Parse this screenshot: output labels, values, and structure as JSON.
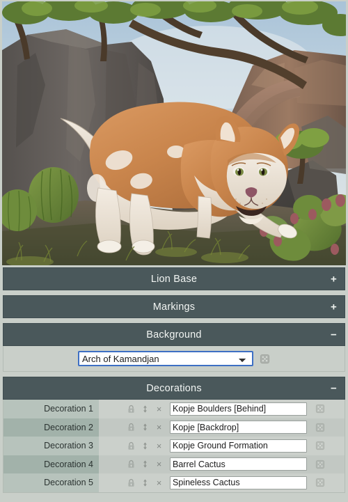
{
  "preview": {
    "alt_title": "Lion Base preview illustration",
    "scene_name": "Arch of Kamandjan",
    "subject": "lioness"
  },
  "sections": [
    {
      "title": "Lion Base",
      "toggle": "+",
      "expanded": false
    },
    {
      "title": "Markings",
      "toggle": "+",
      "expanded": false
    },
    {
      "title": "Background",
      "toggle": "−",
      "expanded": true,
      "select_value": "Arch of Kamandjan",
      "options": [
        "Arch of Kamandjan"
      ],
      "randomize_icon": "dice-icon"
    },
    {
      "title": "Decorations",
      "toggle": "−",
      "expanded": true
    }
  ],
  "decorations": {
    "lock_icon": "lock-icon",
    "move_icon": "move-vertical-icon",
    "remove_icon": "×",
    "randomize_icon": "dice-icon",
    "rows": [
      {
        "label": "Decoration 1",
        "value": "Kopje Boulders [Behind]"
      },
      {
        "label": "Decoration 2",
        "value": "Kopje [Backdrop]"
      },
      {
        "label": "Decoration 3",
        "value": "Kopje Ground Formation"
      },
      {
        "label": "Decoration 4",
        "value": "Barrel Cactus"
      },
      {
        "label": "Decoration 5",
        "value": "Spineless Cactus"
      }
    ]
  },
  "colors": {
    "header_bar": "#4a585b",
    "page_background": "#c9cfc9",
    "label_odd": "#b7c3bc",
    "label_even": "#a2b2aa",
    "focus_outline": "#3d6fc4"
  }
}
